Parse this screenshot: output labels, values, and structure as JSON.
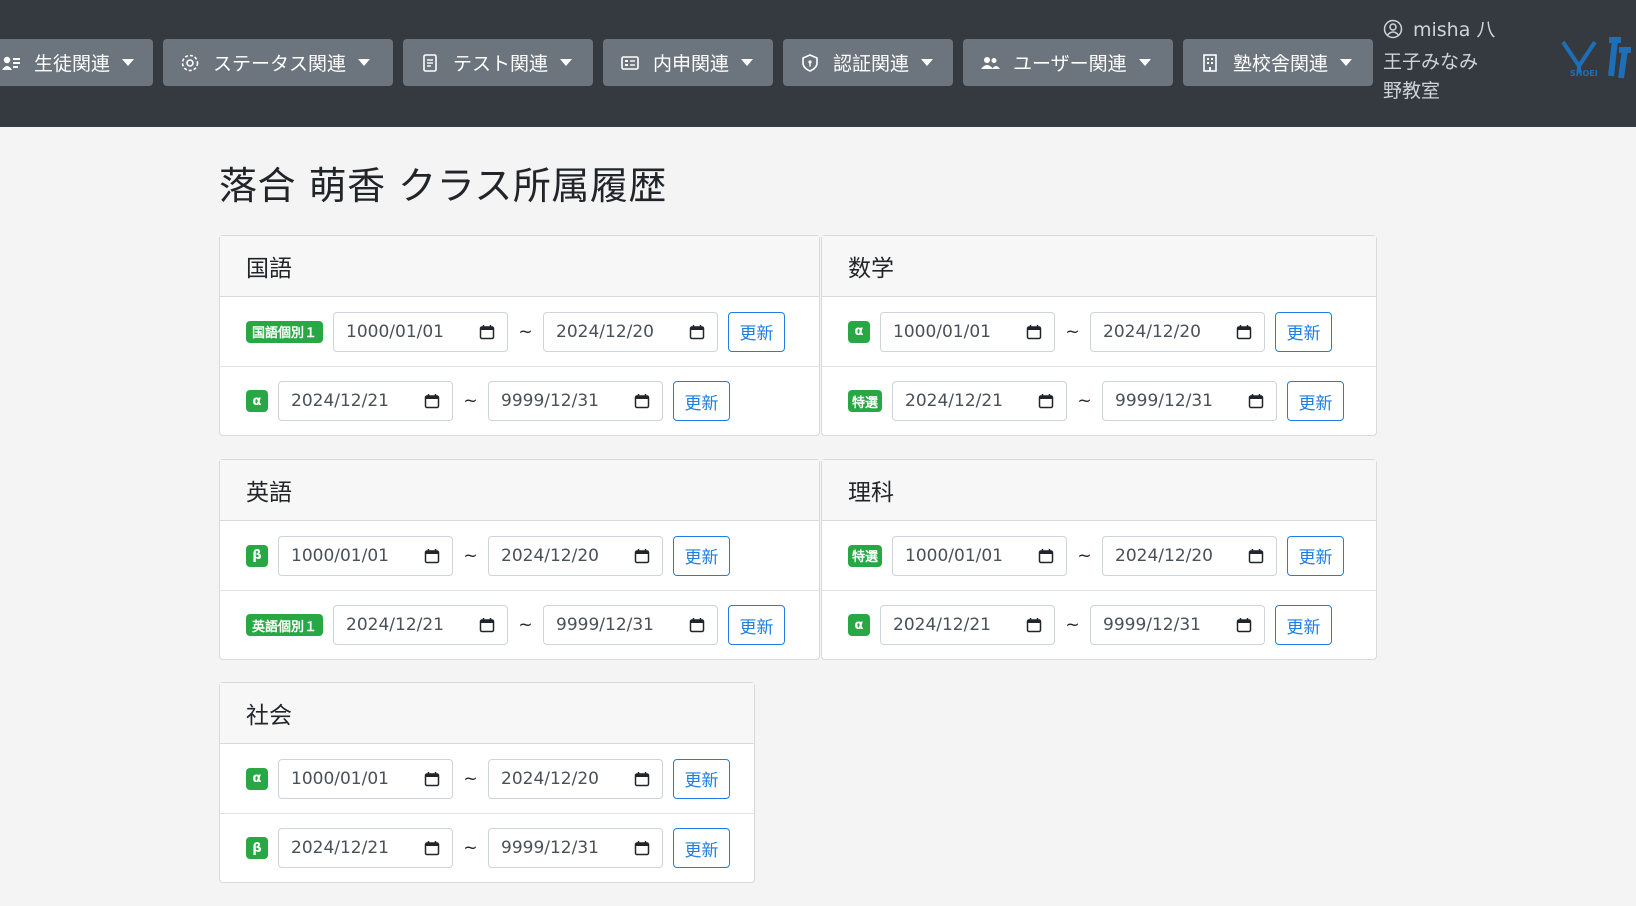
{
  "navbar": {
    "menus": [
      {
        "label": "生徒関連",
        "icon": "student-icon"
      },
      {
        "label": "ステータス関連",
        "icon": "gear-icon"
      },
      {
        "label": "テスト関連",
        "icon": "document-icon"
      },
      {
        "label": "内申関連",
        "icon": "card-icon"
      },
      {
        "label": "認証関連",
        "icon": "shield-icon"
      },
      {
        "label": "ユーザー関連",
        "icon": "users-icon"
      },
      {
        "label": "塾校舎関連",
        "icon": "building-icon"
      }
    ],
    "user": {
      "line1": "misha 八",
      "line2": "王子みなみ",
      "line3": "野教室"
    },
    "logo_text": "SHOEI"
  },
  "page": {
    "title": "落合 萌香 クラス所属履歴"
  },
  "update_label": "更新",
  "tilde": "~",
  "colors": {
    "navbar": "#343a40",
    "nav_button": "#6c757d",
    "badge": "#28a745",
    "primary": "#1e7ee4"
  },
  "subjects": [
    {
      "name": "国語",
      "rows": [
        {
          "badge": "国語個別１",
          "from": "1000/01/01",
          "to": "2024/12/20"
        },
        {
          "badge": "α",
          "from": "2024/12/21",
          "to": "9999/12/31"
        }
      ]
    },
    {
      "name": "数学",
      "rows": [
        {
          "badge": "α",
          "from": "1000/01/01",
          "to": "2024/12/20"
        },
        {
          "badge": "特選",
          "from": "2024/12/21",
          "to": "9999/12/31"
        }
      ]
    },
    {
      "name": "英語",
      "rows": [
        {
          "badge": "β",
          "from": "1000/01/01",
          "to": "2024/12/20"
        },
        {
          "badge": "英語個別１",
          "from": "2024/12/21",
          "to": "9999/12/31"
        }
      ]
    },
    {
      "name": "理科",
      "rows": [
        {
          "badge": "特選",
          "from": "1000/01/01",
          "to": "2024/12/20"
        },
        {
          "badge": "α",
          "from": "2024/12/21",
          "to": "9999/12/31"
        }
      ]
    },
    {
      "name": "社会",
      "rows": [
        {
          "badge": "α",
          "from": "1000/01/01",
          "to": "2024/12/20"
        },
        {
          "badge": "β",
          "from": "2024/12/21",
          "to": "9999/12/31"
        }
      ]
    }
  ]
}
